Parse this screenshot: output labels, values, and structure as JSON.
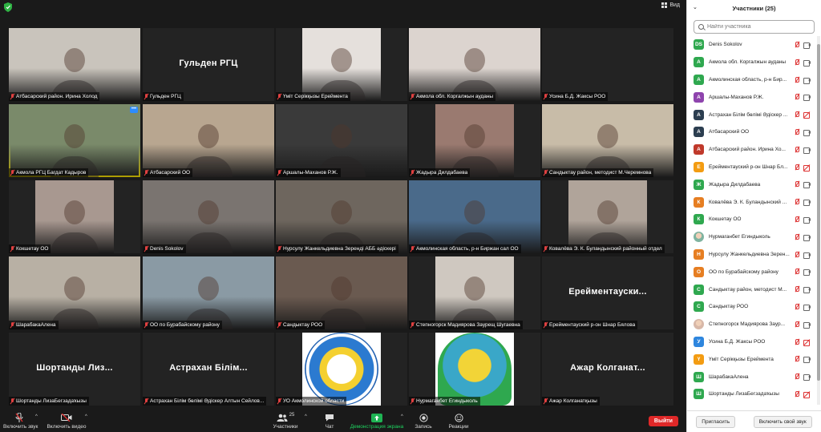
{
  "topbar": {
    "view_label": "Вид"
  },
  "tiles": [
    {
      "name": "Атбасарский район. Ирина Холод",
      "color": "#c9c4bc",
      "frame": "wide"
    },
    {
      "name": "Гульден РГЦ",
      "big": "Гульден РГЦ",
      "color": "#232323",
      "frame": "none"
    },
    {
      "name": "Үміт Серікқызы Ереймента",
      "color": "#e5e0dc",
      "frame": "narrow"
    },
    {
      "name": "Акмола обл. Коргалжын ауданы",
      "color": "#dcd4cf",
      "frame": "wide"
    },
    {
      "name": "Усина Б.Д. Жаксы РОО",
      "color": "#232323",
      "frame": "none"
    },
    {
      "name": "Акмола РГЦ Багдат Кадыров",
      "color": "#7a8a6a",
      "frame": "wide",
      "active": true
    },
    {
      "name": "Атбасарский ОО",
      "color": "#b8a690",
      "frame": "wide"
    },
    {
      "name": "Аршалы-Маханов Р.Ж.",
      "color": "#3a3a3a",
      "frame": "wide"
    },
    {
      "name": "Жадыра Дилдабаева",
      "color": "#9a7a70",
      "frame": "narrow"
    },
    {
      "name": "Сандыктау район, методист М.Черемнова",
      "color": "#c8bca8",
      "frame": "wide"
    },
    {
      "name": "Кокшетау ОО",
      "color": "#a89890",
      "frame": "narrow"
    },
    {
      "name": "Denis Sokolov",
      "color": "#7a7470",
      "frame": "wide"
    },
    {
      "name": "Нурсулу Жанкельдиевна Зеренді АББ әдіскері",
      "color": "#6e665e",
      "frame": "wide"
    },
    {
      "name": "Акмолинская область, р-н Биржан сал ОО",
      "color": "#4a6a8a",
      "frame": "wide"
    },
    {
      "name": "Ковалёва Э. К. Буландынский районный отдел",
      "color": "#b0a49a",
      "frame": "narrow"
    },
    {
      "name": "ШарабакаАлена",
      "color": "#b8b0a4",
      "frame": "wide"
    },
    {
      "name": "ОО по Бурабайскому району",
      "color": "#8a9aa4",
      "frame": "wide"
    },
    {
      "name": "Сандыктау РОО",
      "color": "#6a5a50",
      "frame": "wide"
    },
    {
      "name": "Степногорск Мадиярова Заурещ Шугаевна",
      "color": "#cfc8c0",
      "frame": "narrow"
    },
    {
      "name": "Ерейментауский р-он Шнар Бялова",
      "big": "Ерейментауски...",
      "color": "#232323",
      "frame": "none"
    },
    {
      "name": "Шортанды ЛизаБегзадаҡызы",
      "big": "Шортанды Лиз...",
      "color": "#232323",
      "frame": "none"
    },
    {
      "name": "Астрахан Білім бөлімі Әдіскер Алтын Сейлов...",
      "big": "Астрахан Білім...",
      "color": "#232323",
      "frame": "none"
    },
    {
      "name": "УО Акмолинской области",
      "color": "#ffffff",
      "frame": "logo",
      "logo": "blue"
    },
    {
      "name": "Нурмаганбет Егиндыколь",
      "color": "#ffffff",
      "frame": "logo",
      "logo": "green"
    },
    {
      "name": "Ажар Колганатқызы",
      "big": "Ажар Колганат...",
      "color": "#232323",
      "frame": "none"
    }
  ],
  "toolbar": {
    "mute_label": "Включить звук",
    "video_label": "Включить видео",
    "participants_label": "Участники",
    "participants_count": "25",
    "chat_label": "Чат",
    "share_label": "Демонстрация экрана",
    "record_label": "Запись",
    "reactions_label": "Реакции",
    "leave_label": "Выйти"
  },
  "panel": {
    "title": "Участники (25)",
    "search_placeholder": "Найти участника",
    "invite_label": "Пригласить",
    "unmute_label": "Включить свой звук",
    "participants": [
      {
        "initial": "DS",
        "name": "Denis Sokolov",
        "color": "#2fa84f",
        "cam": "gray"
      },
      {
        "initial": "А",
        "name": "Акмола обл. Коргалжын ауданы",
        "color": "#2fa84f",
        "cam": "gray"
      },
      {
        "initial": "А",
        "name": "Акмолинская область, р-н Бир...",
        "color": "#2fa84f",
        "cam": "gray"
      },
      {
        "initial": "А",
        "name": "Аршалы-Маханов Р.Ж.",
        "color": "#8e44ad",
        "cam": "gray"
      },
      {
        "initial": "А",
        "name": "Астрахан Білім бөлімі Әдіскер ...",
        "color": "#2c3e50",
        "cam": "red"
      },
      {
        "initial": "А",
        "name": "Атбасарский ОО",
        "color": "#2c3e50",
        "cam": "gray"
      },
      {
        "initial": "А",
        "name": "Атбасарский район. Ирина Хо...",
        "color": "#c0392b",
        "cam": "gray"
      },
      {
        "initial": "Е",
        "name": "Ерейментауский р-он Шнар Бл...",
        "color": "#f39c12",
        "cam": "red"
      },
      {
        "initial": "Ж",
        "name": "Жадыра Дилдабаева",
        "color": "#2fa84f",
        "cam": "gray"
      },
      {
        "initial": "К",
        "name": "Ковалёва Э. К. Буландынский ...",
        "color": "#e67e22",
        "cam": "gray"
      },
      {
        "initial": "К",
        "name": "Кокшетау ОО",
        "color": "#2fa84f",
        "cam": "gray"
      },
      {
        "initial": "",
        "name": "Нурмаганбет Егиндыколь",
        "color": "#7fb3a0",
        "cam": "gray",
        "photo": true
      },
      {
        "initial": "Н",
        "name": "Нурсулу Жанкельдиевна Зерен...",
        "color": "#e67e22",
        "cam": "gray"
      },
      {
        "initial": "О",
        "name": "ОО по Бурабайскому району",
        "color": "#e67e22",
        "cam": "gray"
      },
      {
        "initial": "С",
        "name": "Сандыктау район, методист М...",
        "color": "#2fa84f",
        "cam": "gray"
      },
      {
        "initial": "С",
        "name": "Сандыктау РОО",
        "color": "#2fa84f",
        "cam": "gray"
      },
      {
        "initial": "",
        "name": "Степногорск Мадиярова Заур...",
        "color": "#d8b8a8",
        "cam": "gray",
        "photo": true
      },
      {
        "initial": "У",
        "name": "Усина Б.Д. Жаксы РОО",
        "color": "#2e86de",
        "cam": "red"
      },
      {
        "initial": "Ү",
        "name": "Үміт Серікқызы Ереймента",
        "color": "#f39c12",
        "cam": "gray"
      },
      {
        "initial": "Ш",
        "name": "ШарабакаАлена",
        "color": "#2fa84f",
        "cam": "gray"
      },
      {
        "initial": "Ш",
        "name": "Шортанды ЛизаБегзадаҡызы",
        "color": "#2fa84f",
        "cam": "red"
      }
    ]
  }
}
